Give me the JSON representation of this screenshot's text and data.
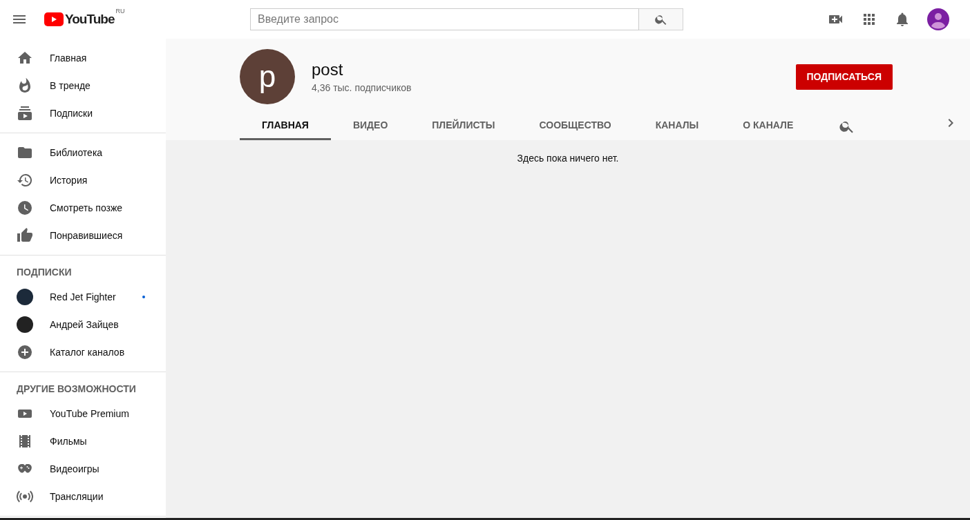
{
  "header": {
    "logo_text": "YouTube",
    "region": "RU",
    "search": {
      "placeholder": "Введите запрос"
    }
  },
  "sidebar": {
    "sections": [
      {
        "items": [
          {
            "kind": "home",
            "label": "Главная",
            "selected": false
          },
          {
            "kind": "trending",
            "label": "В тренде",
            "selected": false
          },
          {
            "kind": "subscriptions",
            "label": "Подписки",
            "selected": false
          }
        ]
      },
      {
        "items": [
          {
            "kind": "library",
            "label": "Библиотека",
            "selected": false
          },
          {
            "kind": "history",
            "label": "История",
            "selected": false
          },
          {
            "kind": "watch-later",
            "label": "Смотреть позже",
            "selected": false
          },
          {
            "kind": "liked",
            "label": "Понравившиеся",
            "selected": false
          }
        ]
      },
      {
        "title": "ПОДПИСКИ",
        "items": [
          {
            "kind": "channel",
            "label": "Red Jet Fighter",
            "selected": false,
            "has_new": true
          },
          {
            "kind": "channel",
            "label": "Андрей Зайцев",
            "selected": false,
            "has_new": false
          },
          {
            "kind": "add",
            "label": "Каталог каналов",
            "selected": false
          }
        ]
      },
      {
        "title": "ДРУГИЕ ВОЗМОЖНОСТИ",
        "items": [
          {
            "kind": "premium",
            "label": "YouTube Premium",
            "selected": false
          },
          {
            "kind": "films",
            "label": "Фильмы",
            "selected": false
          },
          {
            "kind": "games",
            "label": "Видеоигры",
            "selected": false
          },
          {
            "kind": "live",
            "label": "Трансляции",
            "selected": false
          }
        ]
      }
    ]
  },
  "channel": {
    "avatar_letter": "p",
    "name": "post",
    "subscribers": "4,36 тыс. подписчиков",
    "subscribe_button": "ПОДПИСАТЬСЯ",
    "tabs": [
      {
        "label": "ГЛАВНАЯ",
        "selected": true
      },
      {
        "label": "ВИДЕО",
        "selected": false
      },
      {
        "label": "ПЛЕЙЛИСТЫ",
        "selected": false
      },
      {
        "label": "СООБЩЕСТВО",
        "selected": false
      },
      {
        "label": "КАНАЛЫ",
        "selected": false
      },
      {
        "label": "О КАНАЛЕ",
        "selected": false
      }
    ]
  },
  "empty_message": "Здесь пока ничего нет."
}
